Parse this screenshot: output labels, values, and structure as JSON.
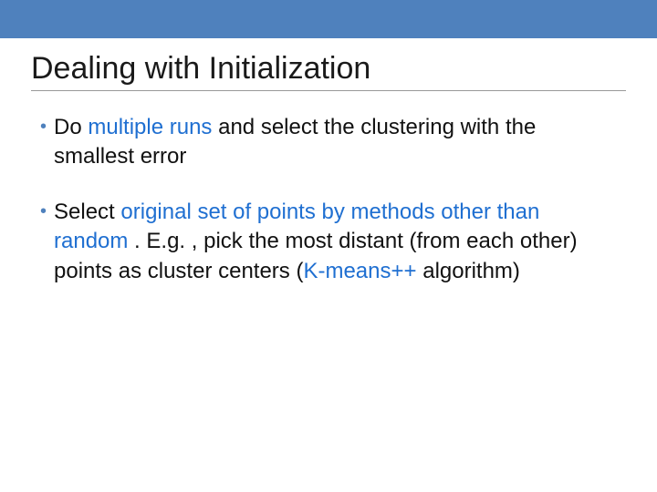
{
  "slide": {
    "title": "Dealing with Initialization",
    "bullets": [
      {
        "parts": [
          {
            "text": "Do ",
            "class": ""
          },
          {
            "text": "multiple runs",
            "class": "blue"
          },
          {
            "text": " and select the clustering with the smallest error",
            "class": ""
          }
        ]
      },
      {
        "parts": [
          {
            "text": "Select ",
            "class": ""
          },
          {
            "text": "original set of  points by methods other than random",
            "class": "blue"
          },
          {
            "text": " . E.g. ,  pick the most distant (from each other) points as cluster centers (",
            "class": ""
          },
          {
            "text": "K-means++",
            "class": "blue"
          },
          {
            "text": " algorithm)",
            "class": ""
          }
        ]
      }
    ]
  }
}
